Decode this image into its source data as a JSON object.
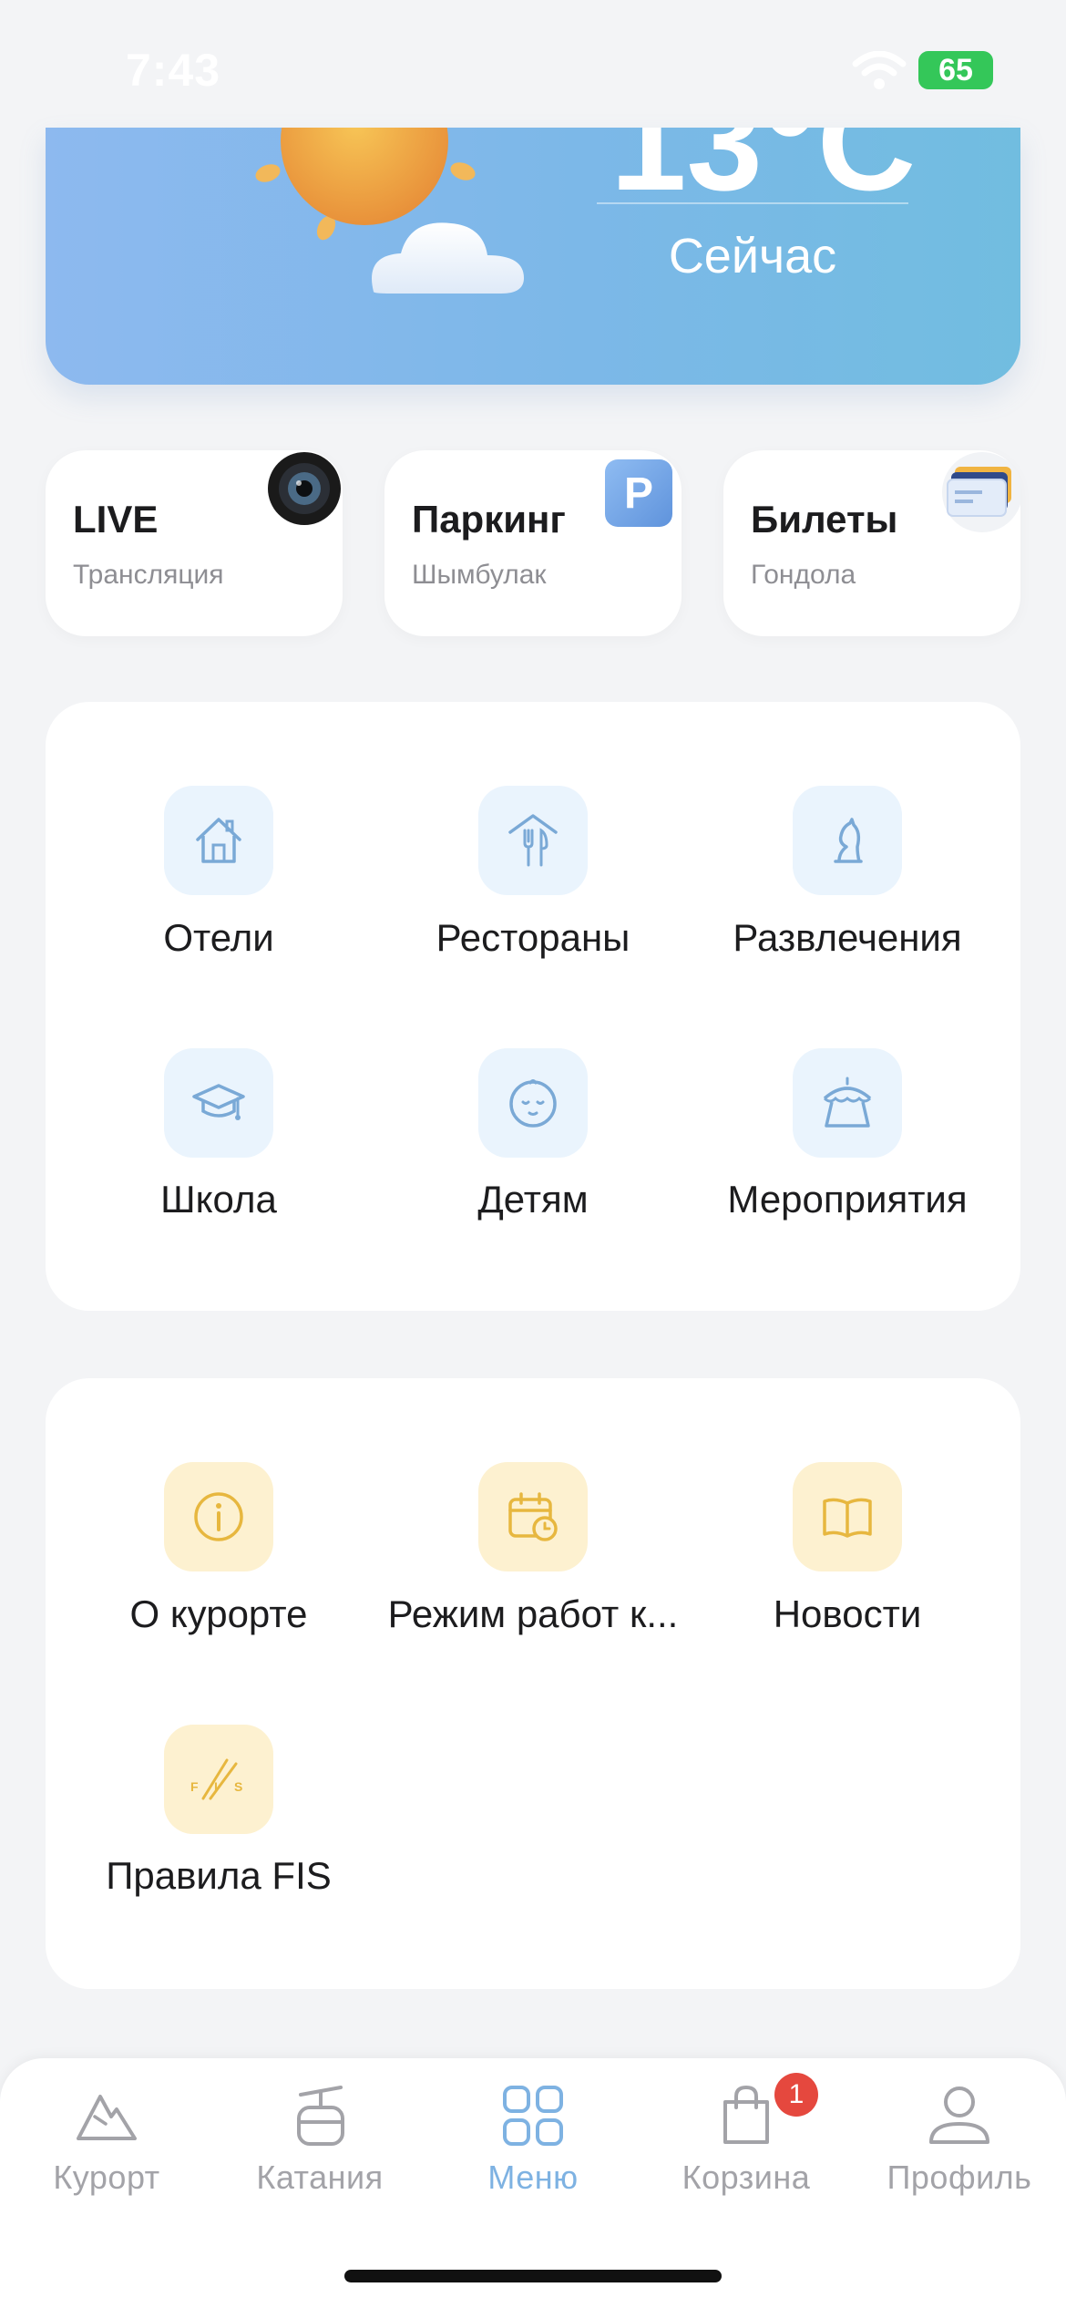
{
  "status_bar": {
    "time": "7:43",
    "battery": "65"
  },
  "weather": {
    "temperature": "13°C",
    "now_label": "Сейчас"
  },
  "quick_tiles": [
    {
      "title": "LIVE",
      "subtitle": "Трансляция",
      "icon": "camera-icon"
    },
    {
      "title": "Паркинг",
      "subtitle": "Шымбулак",
      "icon": "parking-icon",
      "badge_text": "P"
    },
    {
      "title": "Билеты",
      "subtitle": "Гондола",
      "icon": "tickets-icon"
    }
  ],
  "services": [
    {
      "label": "Отели",
      "icon": "house-icon"
    },
    {
      "label": "Рестораны",
      "icon": "fork-knife-icon"
    },
    {
      "label": "Развлечения",
      "icon": "chess-knight-icon"
    },
    {
      "label": "Школа",
      "icon": "graduation-cap-icon"
    },
    {
      "label": "Детям",
      "icon": "baby-face-icon"
    },
    {
      "label": "Мероприятия",
      "icon": "tent-icon"
    }
  ],
  "info": [
    {
      "label": "О курорте",
      "icon": "info-icon"
    },
    {
      "label": "Режим работ к...",
      "icon": "calendar-clock-icon"
    },
    {
      "label": "Новости",
      "icon": "book-icon"
    },
    {
      "label": "Правила FIS",
      "icon": "fis-logo-icon"
    }
  ],
  "tab_bar": {
    "items": [
      {
        "label": "Курорт",
        "icon": "mountain-icon"
      },
      {
        "label": "Катания",
        "icon": "gondola-icon"
      },
      {
        "label": "Меню",
        "icon": "grid-icon",
        "active": true
      },
      {
        "label": "Корзина",
        "icon": "shopping-bag-icon",
        "badge": "1"
      },
      {
        "label": "Профиль",
        "icon": "person-icon"
      }
    ]
  },
  "colors": {
    "accent_blue": "#7eb2e2",
    "icon_blue_bg": "#eaf4fd",
    "icon_yellow_bg": "#fdf1d0",
    "icon_yellow": "#e7b73f",
    "badge_red": "#e5483e",
    "battery_green": "#34c759"
  }
}
